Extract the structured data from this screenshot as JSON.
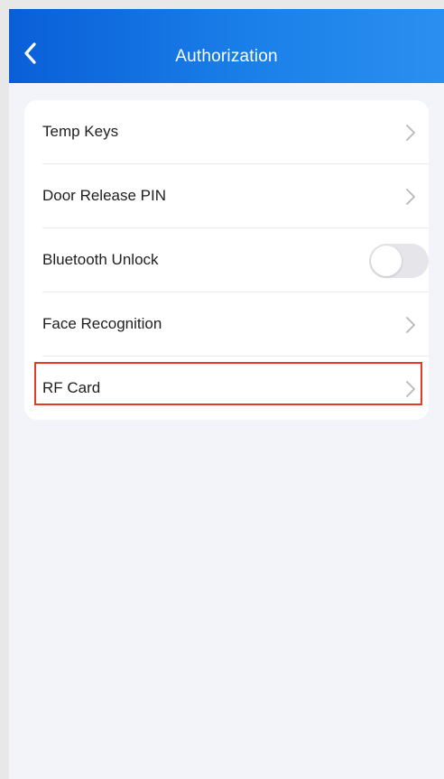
{
  "header": {
    "title": "Authorization",
    "back_icon": "chevron-left-icon"
  },
  "settings": {
    "items": [
      {
        "label": "Temp Keys",
        "control": "chevron"
      },
      {
        "label": "Door Release PIN",
        "control": "chevron"
      },
      {
        "label": "Bluetooth Unlock",
        "control": "toggle",
        "toggle_on": false
      },
      {
        "label": "Face Recognition",
        "control": "chevron"
      },
      {
        "label": "RF Card",
        "control": "chevron",
        "highlighted": true
      }
    ]
  },
  "colors": {
    "header_gradient_start": "#0a5fd8",
    "header_gradient_end": "#2b8ff0",
    "background": "#f3f4f9",
    "highlight_border": "#e43a1f",
    "chevron": "#b7b7bd"
  }
}
